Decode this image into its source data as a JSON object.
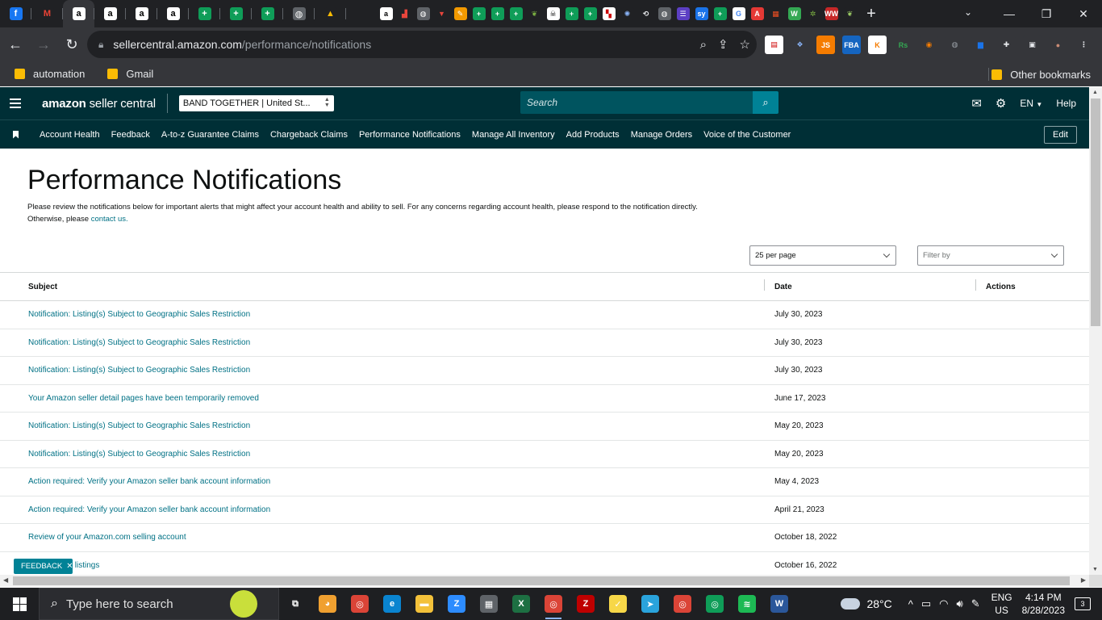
{
  "browser": {
    "tabs": [
      {
        "icon": "facebook-icon",
        "glyph": "f",
        "color": "#1877f2"
      },
      {
        "icon": "gmail-icon",
        "glyph": "M",
        "color": "#202124",
        "fg": "#ea4335"
      },
      {
        "icon": "amazon-icon",
        "glyph": "a",
        "color": "#ffffff",
        "fg": "#000",
        "active": true
      },
      {
        "icon": "amazon-icon",
        "glyph": "a",
        "color": "#ffffff",
        "fg": "#000"
      },
      {
        "icon": "amazon-icon",
        "glyph": "a",
        "color": "#ffffff",
        "fg": "#000"
      },
      {
        "icon": "amazon-icon",
        "glyph": "a",
        "color": "#ffffff",
        "fg": "#000"
      },
      {
        "icon": "sheets-plus-icon",
        "glyph": "+",
        "color": "#0f9d58"
      },
      {
        "icon": "sheets-plus-icon",
        "glyph": "+",
        "color": "#0f9d58"
      },
      {
        "icon": "sheets-plus-icon",
        "glyph": "+",
        "color": "#0f9d58"
      },
      {
        "icon": "globe-icon",
        "glyph": "◍",
        "color": "#5f6368"
      },
      {
        "icon": "drive-icon",
        "glyph": "▲",
        "color": "#202124",
        "fg": "#fbbc04"
      }
    ],
    "pinned_tabs": [
      {
        "icon": "amazon-icon",
        "glyph": "a",
        "color": "#fff",
        "fg": "#000"
      },
      {
        "icon": "chart-icon",
        "glyph": "▟",
        "color": "#202124",
        "fg": "#e8453c"
      },
      {
        "icon": "globe-icon",
        "glyph": "◍",
        "color": "#5f6368"
      },
      {
        "icon": "filter-icon",
        "glyph": "▼",
        "color": "#202124",
        "fg": "#e8453c"
      },
      {
        "icon": "pencil-icon",
        "glyph": "✎",
        "color": "#f29900"
      },
      {
        "icon": "sheets-plus-icon",
        "glyph": "+",
        "color": "#0f9d58"
      },
      {
        "icon": "sheets-plus-icon",
        "glyph": "+",
        "color": "#0f9d58"
      },
      {
        "icon": "sheets-plus-icon",
        "glyph": "+",
        "color": "#0f9d58"
      },
      {
        "icon": "leaf-icon",
        "glyph": "❦",
        "color": "#202124",
        "fg": "#7cb342"
      },
      {
        "icon": "skull-icon",
        "glyph": "☠",
        "color": "#fff",
        "fg": "#000"
      },
      {
        "icon": "sheets-plus-icon",
        "glyph": "+",
        "color": "#0f9d58"
      },
      {
        "icon": "sheets-plus-icon",
        "glyph": "+",
        "color": "#0f9d58"
      },
      {
        "icon": "chart-icon",
        "glyph": "▚",
        "color": "#fff",
        "fg": "#c00"
      },
      {
        "icon": "settings-icon",
        "glyph": "✺",
        "color": "#202124",
        "fg": "#8ab4f8"
      },
      {
        "icon": "history-icon",
        "glyph": "⟲",
        "color": "#202124",
        "fg": "#e8eaed"
      },
      {
        "icon": "globe-icon",
        "glyph": "◍",
        "color": "#5f6368"
      },
      {
        "icon": "list-icon",
        "glyph": "☰",
        "color": "#5c3fc4"
      },
      {
        "icon": "sysco-icon",
        "glyph": "sy",
        "color": "#1a73e8"
      },
      {
        "icon": "sheets-plus-icon",
        "glyph": "+",
        "color": "#0f9d58"
      },
      {
        "icon": "google-icon",
        "glyph": "G",
        "color": "#fff",
        "fg": "#4285f4"
      },
      {
        "icon": "acrobat-icon",
        "glyph": "A",
        "color": "#e53935"
      },
      {
        "icon": "microsoft-icon",
        "glyph": "▦",
        "color": "#202124",
        "fg": "#f25022"
      },
      {
        "icon": "w-icon",
        "glyph": "W",
        "color": "#34a853"
      },
      {
        "icon": "leaf-icon",
        "glyph": "✲",
        "color": "#202124",
        "fg": "#7cb342"
      },
      {
        "icon": "ww-icon",
        "glyph": "WW",
        "color": "#c62828"
      },
      {
        "icon": "leaf-icon",
        "glyph": "❦",
        "color": "#202124",
        "fg": "#9ccc65"
      }
    ],
    "url_host": "sellercentral.amazon.com",
    "url_path": "/performance/notifications",
    "extensions": [
      {
        "icon": "extension-badge-icon",
        "glyph": "▤",
        "color": "#fff",
        "fg": "#c00"
      },
      {
        "icon": "dropbox-icon",
        "glyph": "❖",
        "color": "#35363a",
        "fg": "#8ab4f8"
      },
      {
        "icon": "js-icon",
        "glyph": "JS",
        "color": "#f57c00"
      },
      {
        "icon": "fba-icon",
        "glyph": "FBA",
        "color": "#1565c0"
      },
      {
        "icon": "keepa-icon",
        "glyph": "K",
        "color": "#fff",
        "fg": "#f57c00"
      },
      {
        "icon": "rs-icon",
        "glyph": "Rs",
        "color": "#35363a",
        "fg": "#34a853"
      },
      {
        "icon": "target-icon",
        "glyph": "◉",
        "color": "#35363a",
        "fg": "#f57c00"
      },
      {
        "icon": "globe-icon",
        "glyph": "◍",
        "color": "#35363a",
        "fg": "#9aa0a6"
      },
      {
        "icon": "bars-icon",
        "glyph": "▆",
        "color": "#35363a",
        "fg": "#1a73e8"
      },
      {
        "icon": "puzzle-icon",
        "glyph": "✚",
        "color": "#35363a",
        "fg": "#e8eaed"
      },
      {
        "icon": "sidepanel-icon",
        "glyph": "▣",
        "color": "#35363a",
        "fg": "#e8eaed"
      },
      {
        "icon": "profile-avatar-icon",
        "glyph": "●",
        "color": "#35363a",
        "fg": "#c98b74"
      },
      {
        "icon": "kebab-menu-icon",
        "glyph": "⋮",
        "color": "#35363a",
        "fg": "#e8eaed"
      }
    ],
    "bookmarks": [
      "automation",
      "Gmail"
    ],
    "other_bookmarks": "Other bookmarks"
  },
  "header": {
    "logo_bold": "amazon",
    "logo_rest": " seller central",
    "store_selector": "BAND TOGETHER | United St...",
    "search_placeholder": "Search",
    "language": "EN",
    "help": "Help"
  },
  "nav": {
    "links": [
      "Account Health",
      "Feedback",
      "A-to-z Guarantee Claims",
      "Chargeback Claims",
      "Performance Notifications",
      "Manage All Inventory",
      "Add Products",
      "Manage Orders",
      "Voice of the Customer"
    ],
    "edit_label": "Edit"
  },
  "page": {
    "title": "Performance Notifications",
    "description": "Please review the notifications below for important alerts that might affect your account health and ability to sell. For any concerns regarding account health, please respond to the notification directly. Otherwise, please ",
    "contact_link": "contact us.",
    "per_page": "25 per page",
    "filter_placeholder": "Filter by",
    "columns": {
      "subject": "Subject",
      "date": "Date",
      "actions": "Actions"
    },
    "rows": [
      {
        "subject": "Notification: Listing(s) Subject to Geographic Sales Restriction",
        "date": "July 30, 2023"
      },
      {
        "subject": "Notification: Listing(s) Subject to Geographic Sales Restriction",
        "date": "July 30, 2023"
      },
      {
        "subject": "Notification: Listing(s) Subject to Geographic Sales Restriction",
        "date": "July 30, 2023"
      },
      {
        "subject": "Your Amazon seller detail pages have been temporarily removed",
        "date": "June 17, 2023"
      },
      {
        "subject": "Notification: Listing(s) Subject to Geographic Sales Restriction",
        "date": "May 20, 2023"
      },
      {
        "subject": "Notification: Listing(s) Subject to Geographic Sales Restriction",
        "date": "May 20, 2023"
      },
      {
        "subject": "Action required: Verify your Amazon seller bank account information",
        "date": "May 4, 2023"
      },
      {
        "subject": "Action required: Verify your Amazon seller bank account information",
        "date": "April 21, 2023"
      },
      {
        "subject": "Review of your Amazon.com selling account",
        "date": "October 18, 2022"
      },
      {
        "subject": "Review your listings",
        "date": "October 16, 2022"
      }
    ],
    "feedback_label": "FEEDBACK"
  },
  "taskbar": {
    "search_placeholder": "Type here to search",
    "apps": [
      {
        "icon": "task-view-icon",
        "glyph": "⧉",
        "color": "transparent"
      },
      {
        "icon": "fox-icon",
        "glyph": "◕",
        "color": "#f0a030"
      },
      {
        "icon": "chrome-profile-icon",
        "glyph": "◎",
        "color": "#db4437"
      },
      {
        "icon": "edge-icon",
        "glyph": "e",
        "color": "#0a84d0"
      },
      {
        "icon": "file-explorer-icon",
        "glyph": "▬",
        "color": "#f3c13a"
      },
      {
        "icon": "zoom-icon",
        "glyph": "Z",
        "color": "#2d8cff"
      },
      {
        "icon": "calculator-icon",
        "glyph": "▦",
        "color": "#5f6368"
      },
      {
        "icon": "excel-icon",
        "glyph": "X",
        "color": "#1d6f42"
      },
      {
        "icon": "chrome-icon",
        "glyph": "◎",
        "color": "#db4437",
        "run": true
      },
      {
        "icon": "filezilla-icon",
        "glyph": "Z",
        "color": "#bf0000"
      },
      {
        "icon": "sticky-notes-icon",
        "glyph": "✓",
        "color": "#f7d748"
      },
      {
        "icon": "telegram-icon",
        "glyph": "➤",
        "color": "#2aa3dc"
      },
      {
        "icon": "chrome-profile-icon",
        "glyph": "◎",
        "color": "#db4437"
      },
      {
        "icon": "chrome-profile-icon",
        "glyph": "◎",
        "color": "#0f9d58"
      },
      {
        "icon": "spotify-icon",
        "glyph": "≋",
        "color": "#1db954"
      },
      {
        "icon": "word-icon",
        "glyph": "W",
        "color": "#2b579a"
      }
    ],
    "temperature": "28°C",
    "language_top": "ENG",
    "language_bottom": "US",
    "time": "4:14 PM",
    "date": "8/28/2023",
    "notification_count": "3"
  }
}
